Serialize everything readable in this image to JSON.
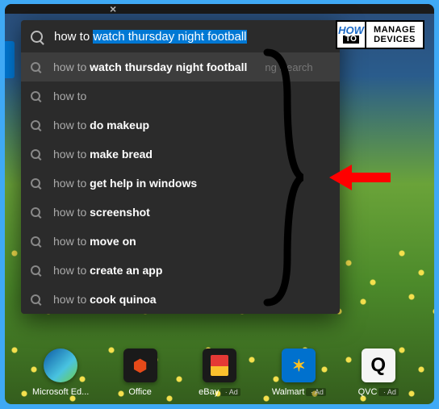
{
  "search": {
    "typed": "how to ",
    "autocomplete": "watch thursday night football"
  },
  "suggestions": [
    {
      "prefix": "how to ",
      "bold": "watch thursday night football",
      "hint": "ng Search",
      "active": true
    },
    {
      "prefix": "how to",
      "bold": "",
      "hint": "",
      "active": false
    },
    {
      "prefix": "how to ",
      "bold": "do makeup",
      "hint": "",
      "active": false
    },
    {
      "prefix": "how to ",
      "bold": "make bread",
      "hint": "",
      "active": false
    },
    {
      "prefix": "how to ",
      "bold": "get help in windows",
      "hint": "",
      "active": false
    },
    {
      "prefix": "how to ",
      "bold": "screenshot",
      "hint": "",
      "active": false
    },
    {
      "prefix": "how to ",
      "bold": "move on",
      "hint": "",
      "active": false
    },
    {
      "prefix": "how to ",
      "bold": "create an app",
      "hint": "",
      "active": false
    },
    {
      "prefix": "how to ",
      "bold": "cook quinoa",
      "hint": "",
      "active": false
    }
  ],
  "logo": {
    "how": "HOW",
    "to": "TO",
    "line1": "MANAGE",
    "line2": "DEVICES"
  },
  "taskbar": [
    {
      "label": "Microsoft Ed...",
      "ad": false,
      "tile": "edge"
    },
    {
      "label": "Office",
      "ad": false,
      "tile": "office"
    },
    {
      "label": "eBay",
      "ad": true,
      "tile": "ebay"
    },
    {
      "label": "Walmart",
      "ad": true,
      "tile": "walmart"
    },
    {
      "label": "QVC",
      "ad": true,
      "tile": "qvc"
    }
  ],
  "adText": "Ad"
}
